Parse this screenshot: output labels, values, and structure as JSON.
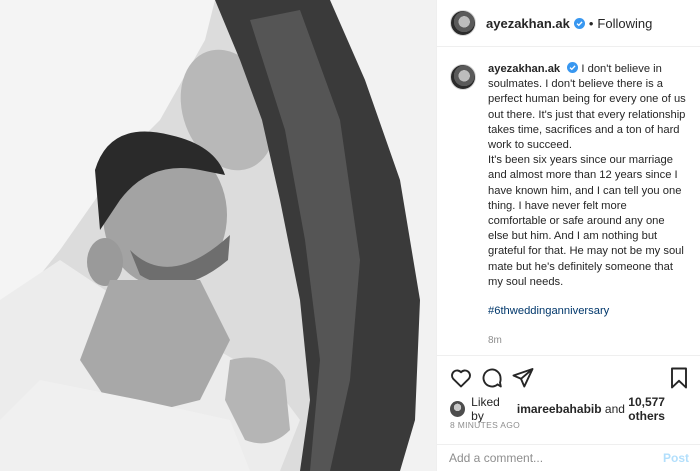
{
  "post": {
    "author": "ayezakhan.ak",
    "follow_state": "Following",
    "separator": "•",
    "caption": "I don't believe in soulmates. I don't believe there is a perfect human being for every one of us out there. It's just that every relationship takes time, sacrifices and a ton of hard work to succeed.",
    "caption_cont": "It's been six years since our marriage and almost more than 12 years since I have known him, and I can tell you one thing. I have never felt more comfortable or safe around any one else but him. And I am nothing but grateful for that. He may not be my soul mate but he's definitely someone that my soul needs.",
    "hashtag": "#6thweddinganniversary",
    "caption_age": "8m"
  },
  "likes": {
    "prefix": "Liked by",
    "user": "imareebahabib",
    "and": "and",
    "count": "10,577 others"
  },
  "timestamp": "8 MINUTES AGO",
  "comment": {
    "placeholder": "Add a comment...",
    "post_label": "Post"
  },
  "icons": [
    "verified-badge-icon",
    "heart-icon",
    "comment-icon",
    "share-icon",
    "bookmark-icon"
  ],
  "colors": {
    "verified": "#3897f0",
    "hashtag": "#00376b",
    "muted": "#8e8e8e",
    "post_button": "#b2dffc"
  }
}
